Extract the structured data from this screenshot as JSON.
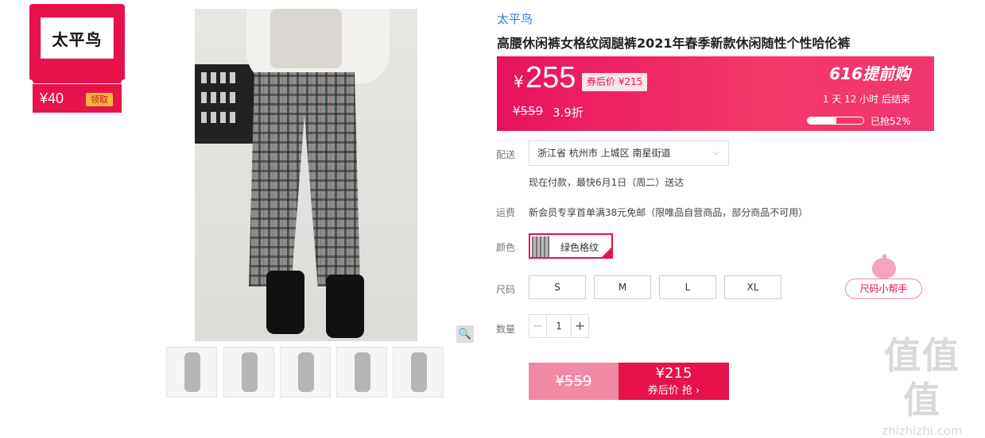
{
  "coupon": {
    "brand_logo": "太平鸟",
    "amount": "¥40",
    "action": "领取"
  },
  "gallery": {
    "zoom_icon": "magnifier-icon",
    "thumbnail_count": 5
  },
  "product": {
    "brand": "太平鸟",
    "title": "高腰休闲裤女格纹阔腿裤2021年春季新款休闲随性个性哈伦裤"
  },
  "price": {
    "currency": "¥",
    "current": "255",
    "coupon_price": "券后价 ¥215",
    "original": "¥559",
    "discount": "3.9折",
    "promo": "616提前购",
    "countdown": "1 天 12 小时 后结束",
    "sold_pct": 52,
    "sold_label": "已抢52%"
  },
  "delivery": {
    "label": "配送",
    "address": "浙江省 杭州市 上城区 南星街道",
    "eta": "现在付款，最快6月1日（周二）送达"
  },
  "shipping": {
    "label": "运费",
    "text": "新会员专享首单满38元免邮（限唯品自营商品，部分商品不可用）"
  },
  "color": {
    "label": "颜色",
    "option": "绿色格纹"
  },
  "size": {
    "label": "尺码",
    "options": [
      "S",
      "M",
      "L",
      "XL"
    ]
  },
  "quantity": {
    "label": "数量",
    "value": "1",
    "minus": "−",
    "plus": "+"
  },
  "buy": {
    "original": "¥559",
    "price": "¥215",
    "action": "券后价 抢 ›"
  },
  "size_helper": {
    "label": "尺码小帮手"
  },
  "watermark": {
    "logo": "值值值",
    "url": "zhizhizhi.com"
  },
  "colors": {
    "accent": "#e8124a",
    "brand_link": "#3a7bd5"
  }
}
